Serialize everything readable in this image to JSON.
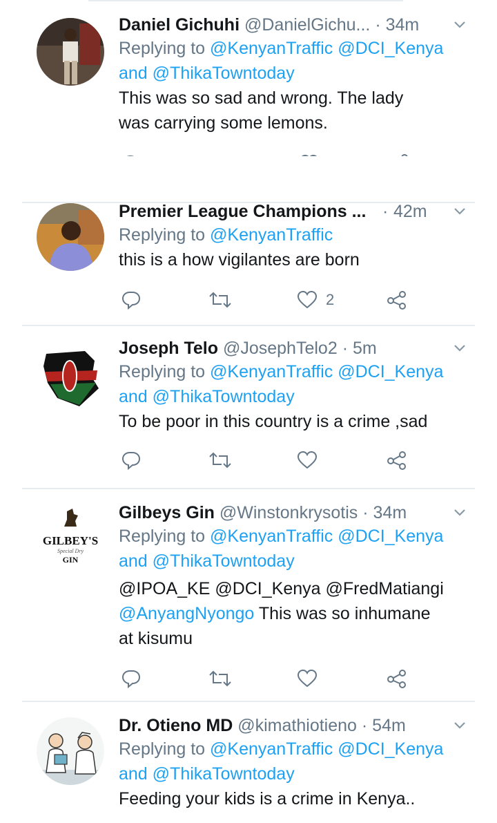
{
  "tweets": [
    {
      "name": "Daniel Gichuhi",
      "handle": "@DanielGichu...",
      "time": "34m",
      "reply_prefix": "Replying to ",
      "reply_line1": "@KenyanTraffic @DCI_Kenya",
      "reply_and": "and ",
      "reply_line2": "@ThikaTowntoday",
      "text_lines": [
        "This was so sad and wrong. The lady",
        "was carrying some lemons."
      ],
      "like_count": "",
      "avatar": "man-standing-photo"
    },
    {
      "name": "Premier League Champions ...",
      "handle": "",
      "time": "42m",
      "reply_prefix": "Replying to ",
      "reply_line1": "@KenyanTraffic",
      "text_lines": [
        "this is a how vigilantes are born"
      ],
      "like_count": "2",
      "avatar": "man-portrait-photo"
    },
    {
      "name": "Joseph Telo",
      "handle": "@JosephTelo2",
      "time": "5m",
      "reply_prefix": "Replying to ",
      "reply_line1": "@KenyanTraffic @DCI_Kenya",
      "reply_and": "and ",
      "reply_line2": "@ThikaTowntoday",
      "text_lines": [
        "To be poor in this country is a crime ,sad"
      ],
      "like_count": "",
      "avatar": "kenya-flag-map"
    },
    {
      "name": "Gilbeys Gin",
      "handle": "@Winstonkrysotis",
      "time": "34m",
      "reply_prefix": "Replying to ",
      "reply_line1": "@KenyanTraffic @DCI_Kenya",
      "reply_and": "and ",
      "reply_line2": "@ThikaTowntoday",
      "mention_line": "@IPOA_KE @DCI_Kenya @FredMatiangi",
      "mention_line2": "@AnyangNyongo",
      "text_after_mention": " This was so inhumane",
      "text_lines": [
        "at kisumu"
      ],
      "like_count": "",
      "avatar": "gilbeys-gin-logo",
      "avatar_text": {
        "brand": "GILBEY'S",
        "script": "Special Dry",
        "product": "GIN"
      }
    },
    {
      "name": "Dr. Otieno MD",
      "handle": "@kimathiotieno",
      "time": "54m",
      "reply_prefix": "Replying to ",
      "reply_line1": "@KenyanTraffic @DCI_Kenya",
      "reply_and": "and ",
      "reply_line2": "@ThikaTowntoday",
      "text_lines": [
        "Feeding your kids is a crime in Kenya.."
      ],
      "like_count": "",
      "avatar": "cartoon-doctors"
    }
  ],
  "separator": "·",
  "colors": {
    "link": "#1da1f2",
    "muted": "#657786",
    "text": "#14171a",
    "divider": "#e6ecf0"
  },
  "icons": {
    "reply": "reply-icon",
    "retweet": "retweet-icon",
    "like": "like-icon",
    "share": "share-icon",
    "menu": "chevron-down-icon"
  }
}
